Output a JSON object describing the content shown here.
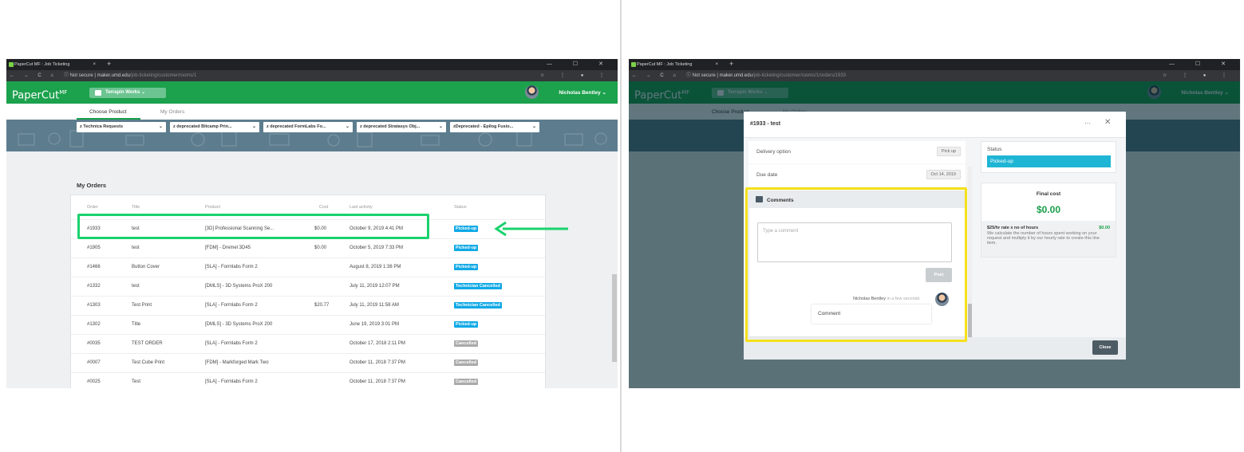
{
  "browser": {
    "tab_title": "PaperCut MF : Job Ticketing",
    "tab_close": "×",
    "new_tab": "+",
    "nav_icons": "← → C ⌂",
    "security": "ⓘ Not secure |",
    "left_url_host": "maker.umd.edu",
    "left_url_path": "/job-ticketing/customer/rooms/1",
    "right_url_host": "maker.umd.edu",
    "right_url_path": "/job-ticketing/customer/rooms/1/orders/1933",
    "window_buttons": "— ☐ ✕",
    "right_icons": "☆ ⋮ ● ⋮"
  },
  "app": {
    "logo": "PaperCut",
    "logo_suffix": "MF",
    "room": "Terrapin Works",
    "room_chevron": "⌄",
    "user": "Nicholas Bentley",
    "user_chevron": "⌄",
    "brand_color": "#1ca14d"
  },
  "tabs": {
    "choose_product": "Choose Product",
    "my_orders": "My Orders"
  },
  "dropdowns": [
    "z Technica Requests",
    "z deprecated Bitcamp Prin...",
    "z deprecated FormLabs Fo...",
    "z deprecated Stratasys Obj...",
    "zDeprecated - Epilog Fusio..."
  ],
  "dropdown_chevron": "⌄",
  "orders": {
    "heading": "My Orders",
    "columns": [
      "Order",
      "Title",
      "Product",
      "Cost",
      "Last activity",
      "Status"
    ],
    "rows": [
      {
        "order": "#1933",
        "title": "test",
        "product": "[3D] Professional Scanning Se...",
        "cost": "$0.00",
        "activity": "October 9, 2019 4:41 PM",
        "status": "Picked-up"
      },
      {
        "order": "#1905",
        "title": "test",
        "product": "[FDM] - Dremel 3D45",
        "cost": "$0.00",
        "activity": "October 5, 2019 7:33 PM",
        "status": "Picked-up"
      },
      {
        "order": "#1466",
        "title": "Button Cover",
        "product": "[SLA] - Formlabs Form 2",
        "cost": "",
        "activity": "August 8, 2019 1:38 PM",
        "status": "Picked-up"
      },
      {
        "order": "#1332",
        "title": "test",
        "product": "[DMLS] - 3D Systems ProX 200",
        "cost": "",
        "activity": "July 11, 2019 12:07 PM",
        "status": "Technician Cancelled"
      },
      {
        "order": "#1303",
        "title": "Test Print",
        "product": "[SLA] - Formlabs Form 2",
        "cost": "$20.77",
        "activity": "July 11, 2019 11:58 AM",
        "status": "Technician Cancelled"
      },
      {
        "order": "#1302",
        "title": "Title",
        "product": "[DMLS] - 3D Systems ProX 200",
        "cost": "",
        "activity": "June 19, 2019 3:01 PM",
        "status": "Picked-up"
      },
      {
        "order": "#0035",
        "title": "TEST ORDER",
        "product": "[SLA] - Formlabs Form 2",
        "cost": "",
        "activity": "October 17, 2018 2:11 PM",
        "status": "Cancelled"
      },
      {
        "order": "#0007",
        "title": "Test Cube Print",
        "product": "[FDM] - Markforged Mark Two",
        "cost": "",
        "activity": "October 11, 2018 7:37 PM",
        "status": "Cancelled"
      },
      {
        "order": "#0025",
        "title": "Test",
        "product": "[SLA] - Formlabs Form 2",
        "cost": "",
        "activity": "October 11, 2018 7:37 PM",
        "status": "Cancelled"
      }
    ]
  },
  "modal": {
    "title": "#1933  -  test",
    "more": "···",
    "close_x": "✕",
    "delivery_label": "Delivery option",
    "delivery_value": "Pick up",
    "due_label": "Due date",
    "due_value": "Oct 14, 2019",
    "comments_heading": "Comments",
    "comment_placeholder": "Type a comment",
    "post": "Post",
    "comment_author": "Nicholas Bentley",
    "comment_time": "in a few seconds",
    "comment_text": "Comment",
    "status_label": "Status",
    "status_value": "Picked-up",
    "final_cost_label": "Final cost",
    "final_cost_value": "$0.00",
    "rate_title": "$25/hr rate x no of hours",
    "rate_amount": "$0.00",
    "rate_desc": "We calculate the number of hours spent working on your request and multiply it by our hourly rate to create this line item.",
    "close_button": "Close"
  },
  "annotations": {
    "arrow_color": "#19d26d",
    "highlight_color": "#f5e11a"
  }
}
